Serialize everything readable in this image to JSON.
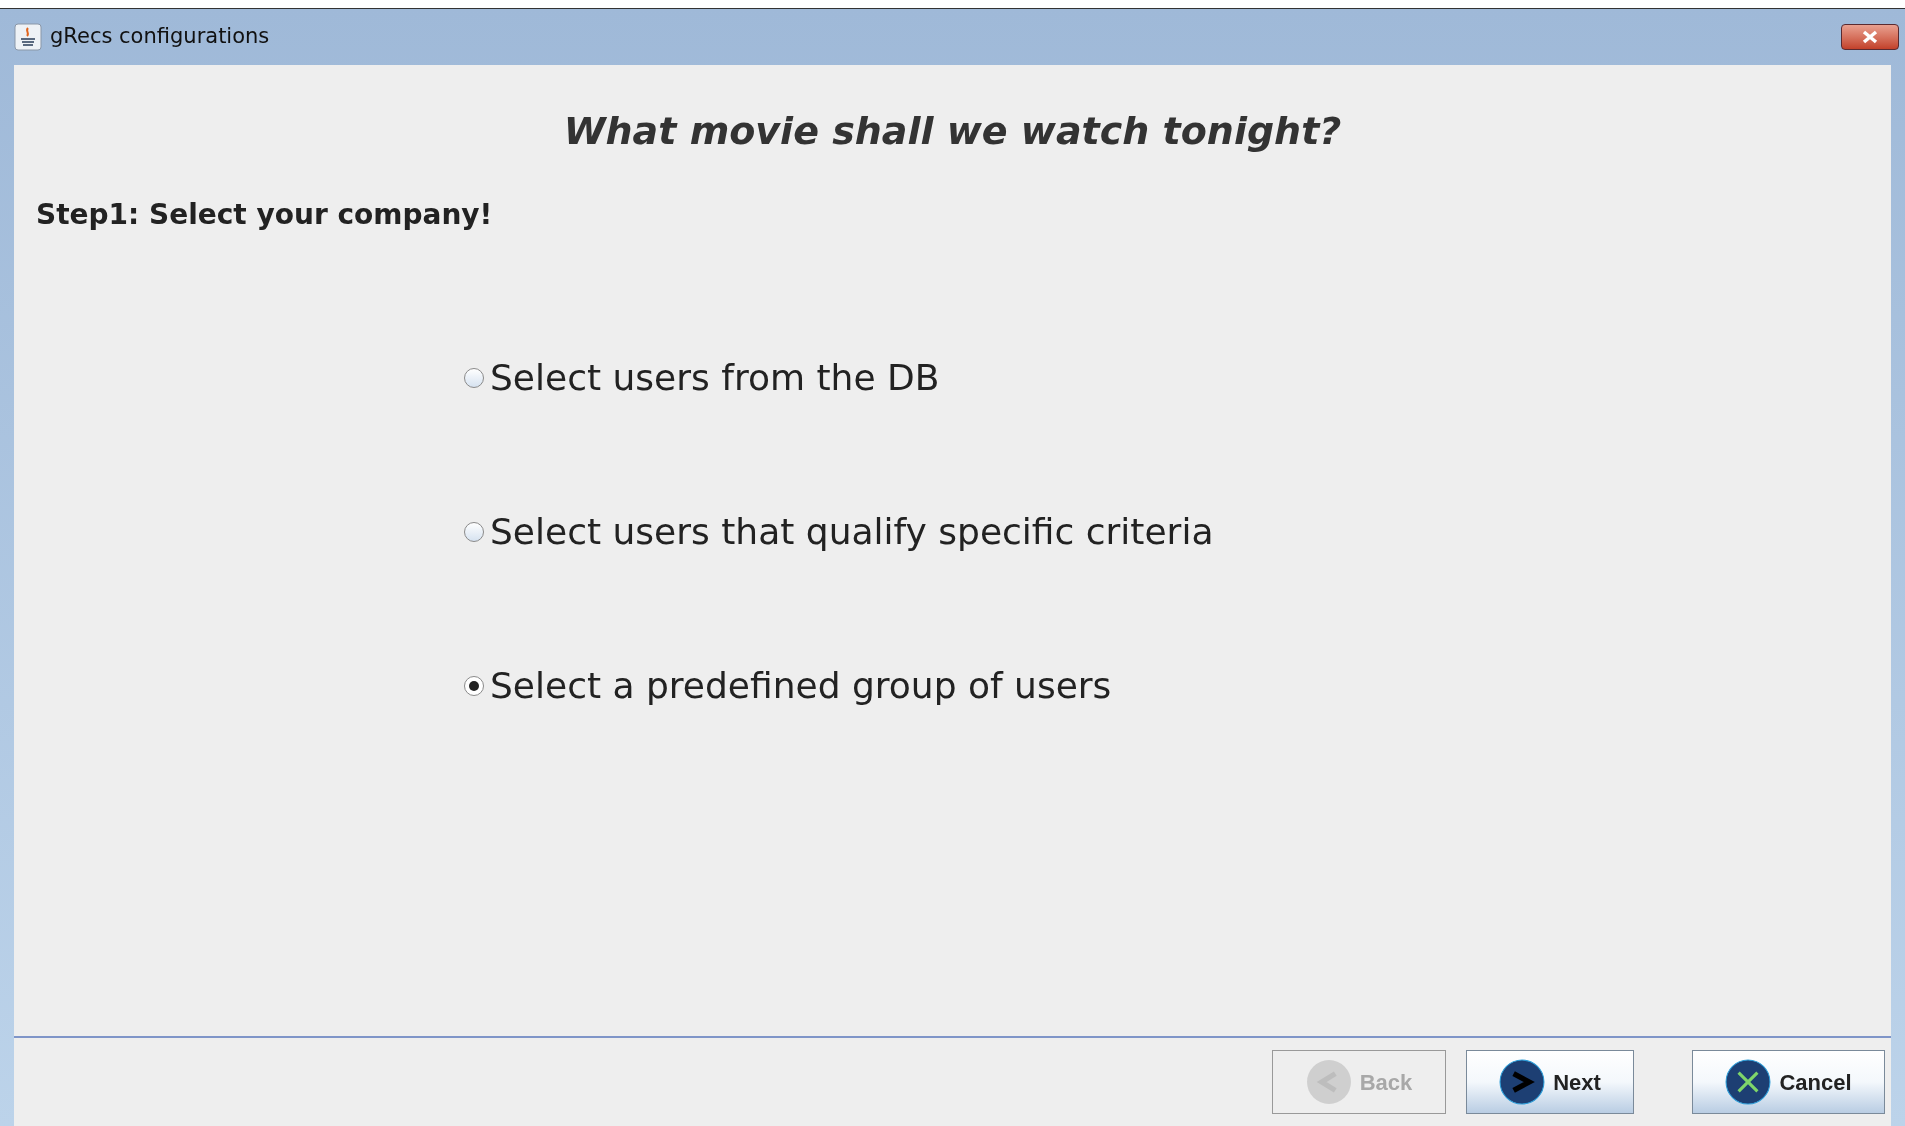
{
  "window": {
    "title": "gRecs configurations"
  },
  "heading": "What movie shall we watch tonight?",
  "step": "Step1: Select your company!",
  "options": [
    {
      "label": "Select users from the DB",
      "selected": false
    },
    {
      "label": "Select users that qualify specific criteria",
      "selected": false
    },
    {
      "label": "Select a predefined group of users",
      "selected": true
    }
  ],
  "buttons": [
    {
      "label": "Back",
      "kind": "back",
      "disabled": true
    },
    {
      "label": "Next",
      "kind": "next",
      "disabled": false
    },
    {
      "label": "Cancel",
      "kind": "cancel",
      "disabled": false
    }
  ]
}
